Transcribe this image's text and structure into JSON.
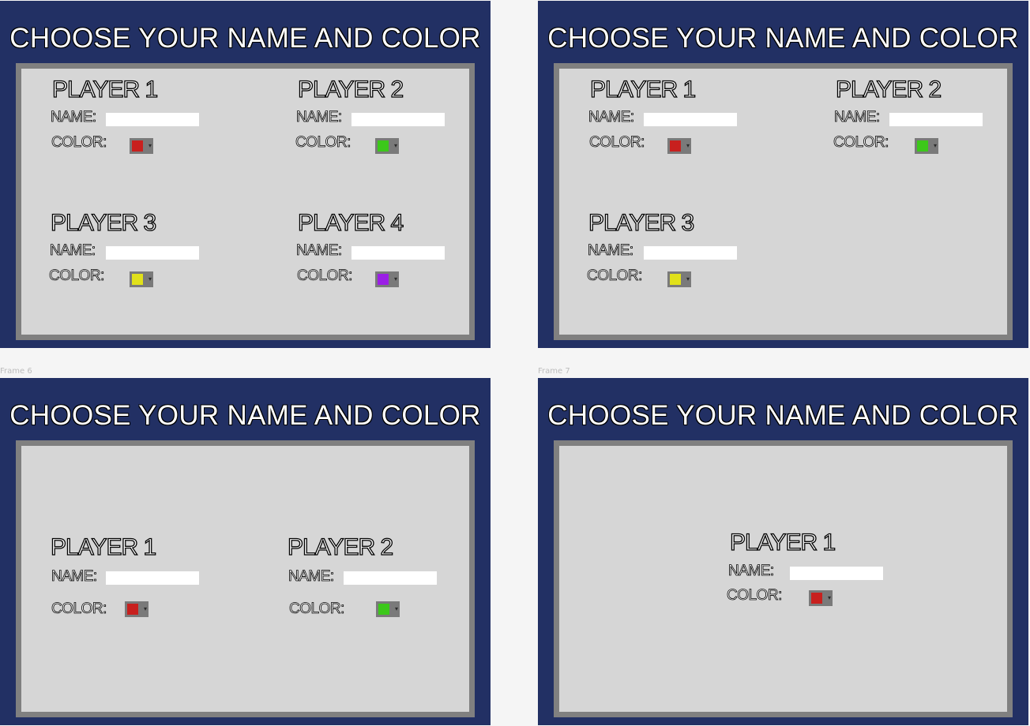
{
  "frames": [
    {
      "label": "",
      "title": "CHOOSE YOUR NAME AND COLOR",
      "players": [
        {
          "title": "PLAYER 1",
          "name_label": "NAME:",
          "color_label": "COLOR:",
          "color": "#c8201e"
        },
        {
          "title": "PLAYER 2",
          "name_label": "NAME:",
          "color_label": "COLOR:",
          "color": "#3cc81a"
        },
        {
          "title": "PLAYER 3",
          "name_label": "NAME:",
          "color_label": "COLOR:",
          "color": "#e1e11a"
        },
        {
          "title": "PLAYER 4",
          "name_label": "NAME:",
          "color_label": "COLOR:",
          "color": "#9b1ee6"
        }
      ]
    },
    {
      "label": "",
      "title": "CHOOSE YOUR NAME AND COLOR",
      "players": [
        {
          "title": "PLAYER 1",
          "name_label": "NAME:",
          "color_label": "COLOR:",
          "color": "#c8201e"
        },
        {
          "title": "PLAYER 2",
          "name_label": "NAME:",
          "color_label": "COLOR:",
          "color": "#3cc81a"
        },
        {
          "title": "PLAYER 3",
          "name_label": "NAME:",
          "color_label": "COLOR:",
          "color": "#e1e11a"
        }
      ]
    },
    {
      "label": "Frame 6",
      "title": "CHOOSE YOUR NAME AND COLOR",
      "players": [
        {
          "title": "PLAYER 1",
          "name_label": "NAME:",
          "color_label": "COLOR:",
          "color": "#c8201e"
        },
        {
          "title": "PLAYER 2",
          "name_label": "NAME:",
          "color_label": "COLOR:",
          "color": "#3cc81a"
        }
      ]
    },
    {
      "label": "Frame 7",
      "title": "CHOOSE YOUR NAME AND COLOR",
      "players": [
        {
          "title": "PLAYER 1",
          "name_label": "NAME:",
          "color_label": "COLOR:",
          "color": "#c8201e"
        }
      ]
    }
  ]
}
